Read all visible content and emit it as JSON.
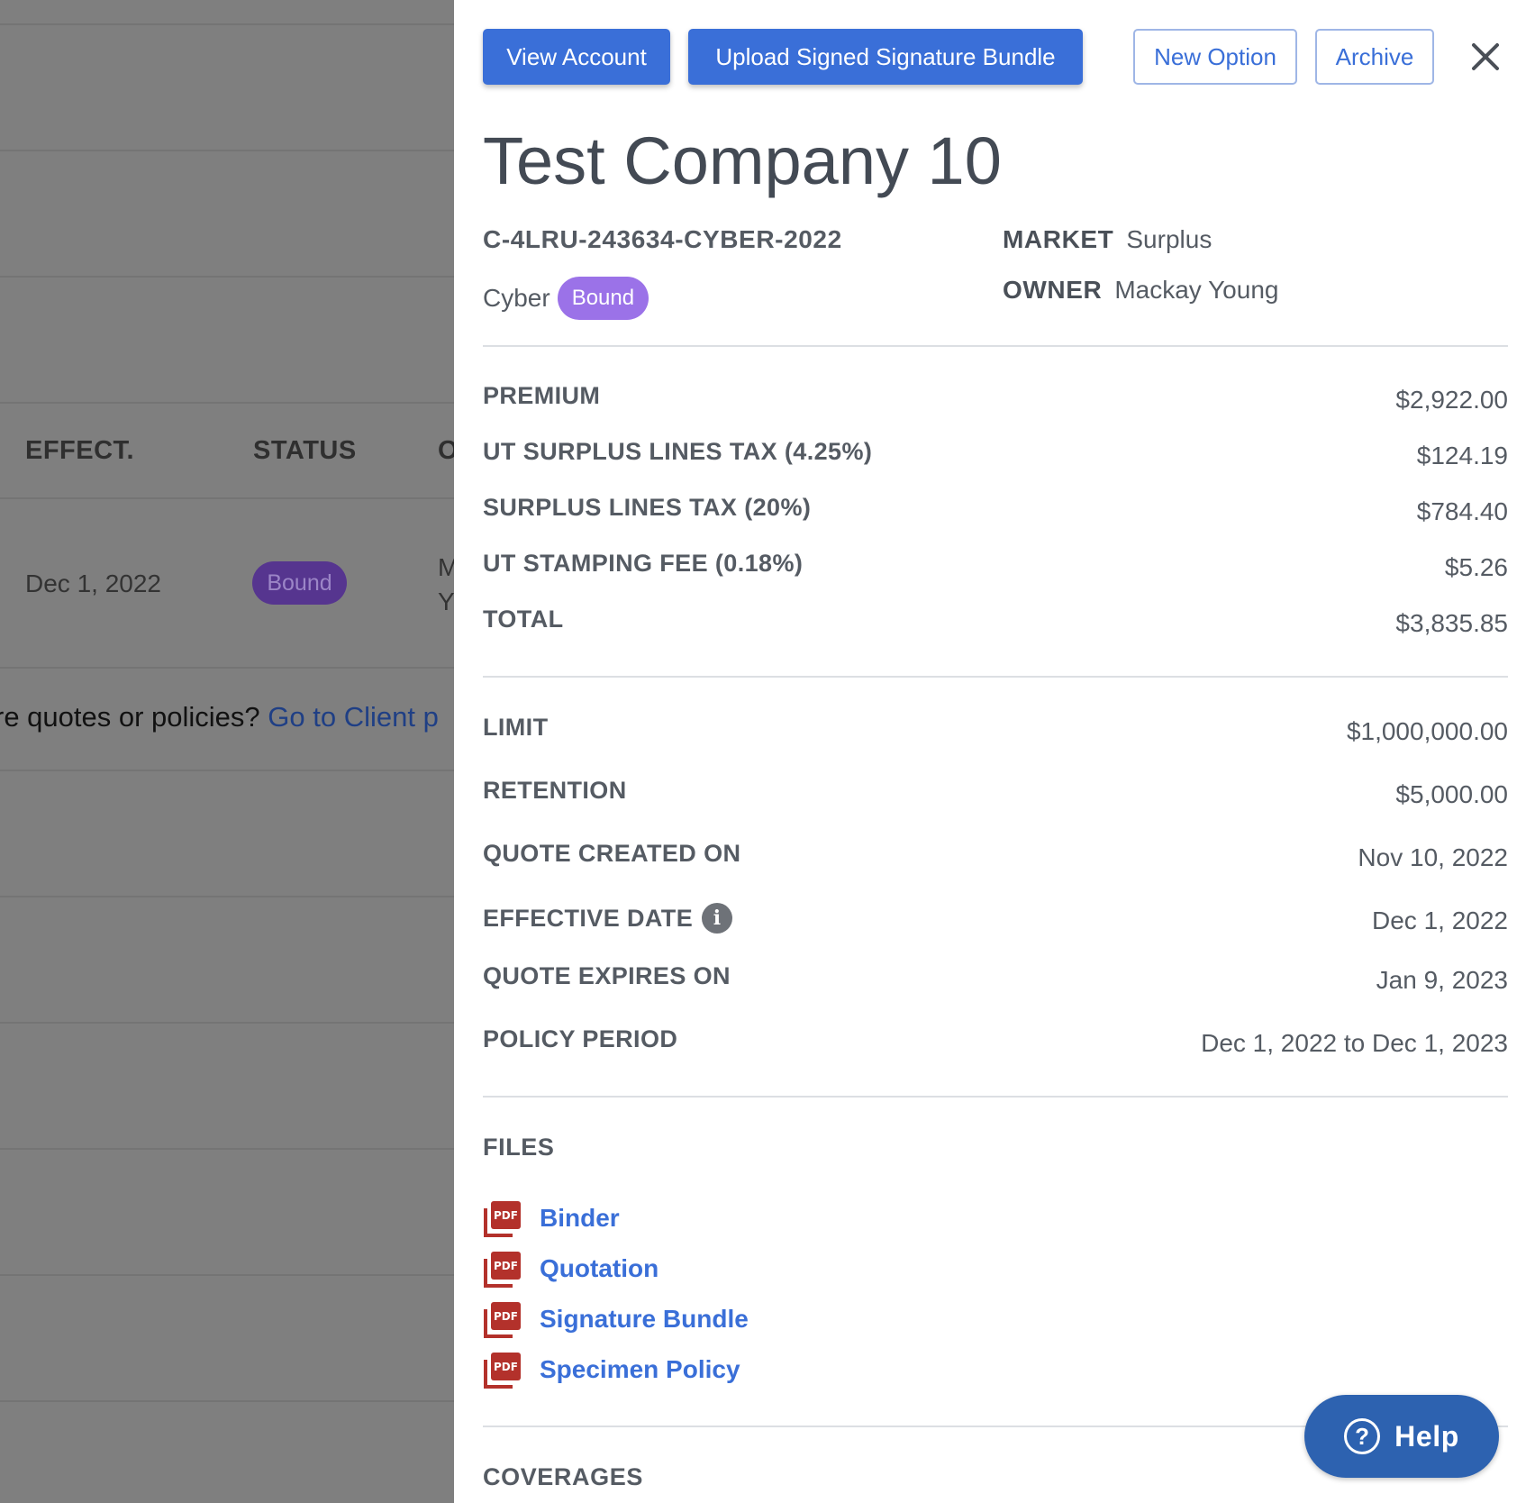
{
  "background": {
    "columns": [
      "EFFECT.",
      "STATUS",
      "O"
    ],
    "row": {
      "effective": "Dec 1, 2022",
      "status": "Bound",
      "owner_line1": "M",
      "owner_line2": "Y"
    },
    "prompt_text": "re quotes or policies?",
    "prompt_link": "Go to Client p"
  },
  "toolbar": {
    "view_account": "View Account",
    "upload_bundle": "Upload Signed Signature Bundle",
    "new_option": "New Option",
    "archive": "Archive"
  },
  "header": {
    "title": "Test Company 10",
    "reference": "C-4LRU-243634-CYBER-2022",
    "line": "Cyber",
    "status": "Bound",
    "market_label": "MARKET",
    "market_value": "Surplus",
    "owner_label": "OWNER",
    "owner_value": "Mackay Young"
  },
  "pricing": [
    {
      "label": "PREMIUM",
      "value": "$2,922.00"
    },
    {
      "label": "UT SURPLUS LINES TAX (4.25%)",
      "value": "$124.19"
    },
    {
      "label": "SURPLUS LINES TAX (20%)",
      "value": "$784.40"
    },
    {
      "label": "UT STAMPING FEE (0.18%)",
      "value": "$5.26"
    },
    {
      "label": "TOTAL",
      "value": "$3,835.85"
    }
  ],
  "details": [
    {
      "label": "LIMIT",
      "value": "$1,000,000.00"
    },
    {
      "label": "RETENTION",
      "value": "$5,000.00"
    },
    {
      "label": "QUOTE CREATED ON",
      "value": "Nov 10, 2022"
    },
    {
      "label": "EFFECTIVE DATE",
      "value": "Dec 1, 2022"
    },
    {
      "label": "QUOTE EXPIRES ON",
      "value": "Jan 9, 2023"
    },
    {
      "label": "POLICY PERIOD",
      "value": "Dec 1, 2022 to Dec 1, 2023"
    }
  ],
  "files": {
    "heading": "FILES",
    "items": [
      "Binder",
      "Quotation",
      "Signature Bundle",
      "Specimen Policy"
    ]
  },
  "coverages": {
    "heading": "COVERAGES"
  },
  "help": {
    "label": "Help"
  },
  "colors": {
    "primary": "#3a6fd8",
    "bound_pill": "#9b72e8",
    "help": "#2d62b0",
    "pdf_red": "#b3312b"
  },
  "icons": {
    "close": "close-icon",
    "info": "info-icon",
    "pdf": "pdf-file-icon",
    "help": "question-circle-icon"
  }
}
